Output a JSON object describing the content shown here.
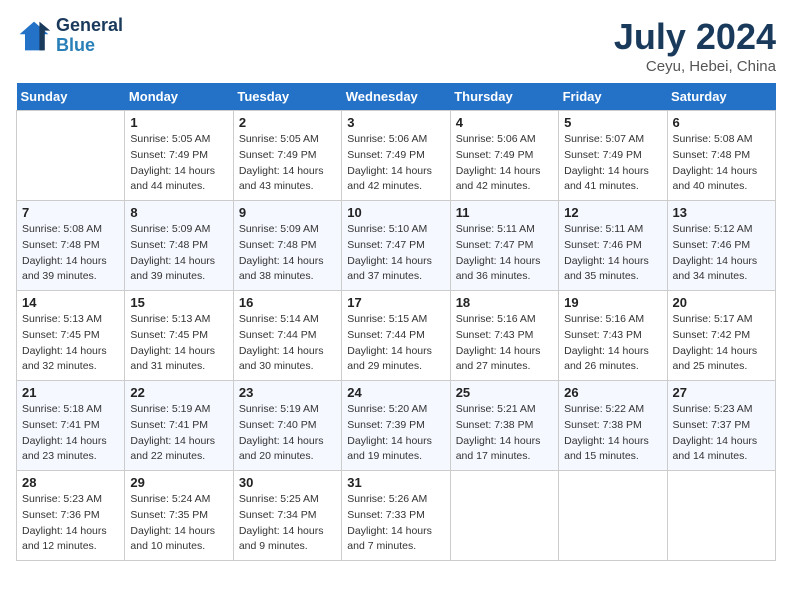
{
  "header": {
    "logo_line1": "General",
    "logo_line2": "Blue",
    "month_title": "July 2024",
    "location": "Ceyu, Hebei, China"
  },
  "days_of_week": [
    "Sunday",
    "Monday",
    "Tuesday",
    "Wednesday",
    "Thursday",
    "Friday",
    "Saturday"
  ],
  "weeks": [
    [
      {
        "day": "",
        "info": ""
      },
      {
        "day": "1",
        "info": "Sunrise: 5:05 AM\nSunset: 7:49 PM\nDaylight: 14 hours\nand 44 minutes."
      },
      {
        "day": "2",
        "info": "Sunrise: 5:05 AM\nSunset: 7:49 PM\nDaylight: 14 hours\nand 43 minutes."
      },
      {
        "day": "3",
        "info": "Sunrise: 5:06 AM\nSunset: 7:49 PM\nDaylight: 14 hours\nand 42 minutes."
      },
      {
        "day": "4",
        "info": "Sunrise: 5:06 AM\nSunset: 7:49 PM\nDaylight: 14 hours\nand 42 minutes."
      },
      {
        "day": "5",
        "info": "Sunrise: 5:07 AM\nSunset: 7:49 PM\nDaylight: 14 hours\nand 41 minutes."
      },
      {
        "day": "6",
        "info": "Sunrise: 5:08 AM\nSunset: 7:48 PM\nDaylight: 14 hours\nand 40 minutes."
      }
    ],
    [
      {
        "day": "7",
        "info": "Sunrise: 5:08 AM\nSunset: 7:48 PM\nDaylight: 14 hours\nand 39 minutes."
      },
      {
        "day": "8",
        "info": "Sunrise: 5:09 AM\nSunset: 7:48 PM\nDaylight: 14 hours\nand 39 minutes."
      },
      {
        "day": "9",
        "info": "Sunrise: 5:09 AM\nSunset: 7:48 PM\nDaylight: 14 hours\nand 38 minutes."
      },
      {
        "day": "10",
        "info": "Sunrise: 5:10 AM\nSunset: 7:47 PM\nDaylight: 14 hours\nand 37 minutes."
      },
      {
        "day": "11",
        "info": "Sunrise: 5:11 AM\nSunset: 7:47 PM\nDaylight: 14 hours\nand 36 minutes."
      },
      {
        "day": "12",
        "info": "Sunrise: 5:11 AM\nSunset: 7:46 PM\nDaylight: 14 hours\nand 35 minutes."
      },
      {
        "day": "13",
        "info": "Sunrise: 5:12 AM\nSunset: 7:46 PM\nDaylight: 14 hours\nand 34 minutes."
      }
    ],
    [
      {
        "day": "14",
        "info": "Sunrise: 5:13 AM\nSunset: 7:45 PM\nDaylight: 14 hours\nand 32 minutes."
      },
      {
        "day": "15",
        "info": "Sunrise: 5:13 AM\nSunset: 7:45 PM\nDaylight: 14 hours\nand 31 minutes."
      },
      {
        "day": "16",
        "info": "Sunrise: 5:14 AM\nSunset: 7:44 PM\nDaylight: 14 hours\nand 30 minutes."
      },
      {
        "day": "17",
        "info": "Sunrise: 5:15 AM\nSunset: 7:44 PM\nDaylight: 14 hours\nand 29 minutes."
      },
      {
        "day": "18",
        "info": "Sunrise: 5:16 AM\nSunset: 7:43 PM\nDaylight: 14 hours\nand 27 minutes."
      },
      {
        "day": "19",
        "info": "Sunrise: 5:16 AM\nSunset: 7:43 PM\nDaylight: 14 hours\nand 26 minutes."
      },
      {
        "day": "20",
        "info": "Sunrise: 5:17 AM\nSunset: 7:42 PM\nDaylight: 14 hours\nand 25 minutes."
      }
    ],
    [
      {
        "day": "21",
        "info": "Sunrise: 5:18 AM\nSunset: 7:41 PM\nDaylight: 14 hours\nand 23 minutes."
      },
      {
        "day": "22",
        "info": "Sunrise: 5:19 AM\nSunset: 7:41 PM\nDaylight: 14 hours\nand 22 minutes."
      },
      {
        "day": "23",
        "info": "Sunrise: 5:19 AM\nSunset: 7:40 PM\nDaylight: 14 hours\nand 20 minutes."
      },
      {
        "day": "24",
        "info": "Sunrise: 5:20 AM\nSunset: 7:39 PM\nDaylight: 14 hours\nand 19 minutes."
      },
      {
        "day": "25",
        "info": "Sunrise: 5:21 AM\nSunset: 7:38 PM\nDaylight: 14 hours\nand 17 minutes."
      },
      {
        "day": "26",
        "info": "Sunrise: 5:22 AM\nSunset: 7:38 PM\nDaylight: 14 hours\nand 15 minutes."
      },
      {
        "day": "27",
        "info": "Sunrise: 5:23 AM\nSunset: 7:37 PM\nDaylight: 14 hours\nand 14 minutes."
      }
    ],
    [
      {
        "day": "28",
        "info": "Sunrise: 5:23 AM\nSunset: 7:36 PM\nDaylight: 14 hours\nand 12 minutes."
      },
      {
        "day": "29",
        "info": "Sunrise: 5:24 AM\nSunset: 7:35 PM\nDaylight: 14 hours\nand 10 minutes."
      },
      {
        "day": "30",
        "info": "Sunrise: 5:25 AM\nSunset: 7:34 PM\nDaylight: 14 hours\nand 9 minutes."
      },
      {
        "day": "31",
        "info": "Sunrise: 5:26 AM\nSunset: 7:33 PM\nDaylight: 14 hours\nand 7 minutes."
      },
      {
        "day": "",
        "info": ""
      },
      {
        "day": "",
        "info": ""
      },
      {
        "day": "",
        "info": ""
      }
    ]
  ]
}
